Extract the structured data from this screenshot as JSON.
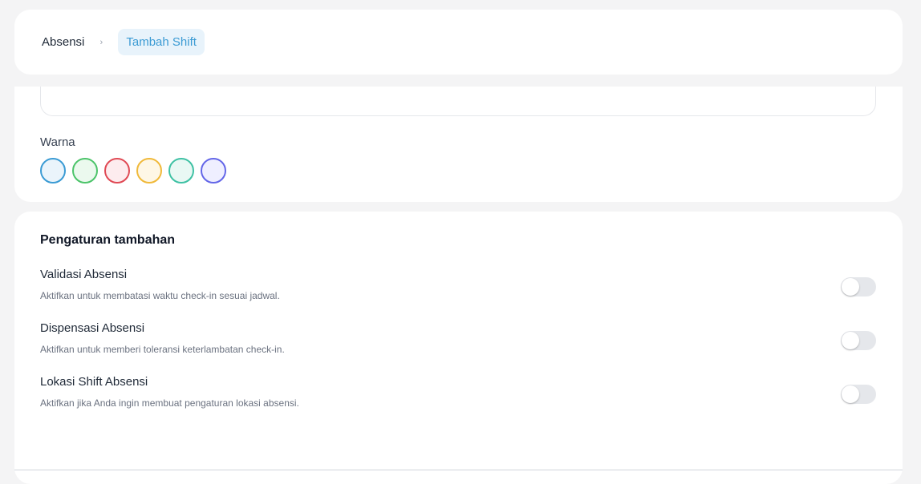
{
  "breadcrumb": {
    "root": "Absensi",
    "current": "Tambah Shift"
  },
  "form": {
    "color_label": "Warna",
    "colors": [
      {
        "name": "blue",
        "border": "#3b9bd4",
        "fill": "#eaf4fb"
      },
      {
        "name": "green",
        "border": "#4cc46a",
        "fill": "#ebf9ee"
      },
      {
        "name": "red",
        "border": "#e04a55",
        "fill": "#fdecee"
      },
      {
        "name": "yellow",
        "border": "#f0b93a",
        "fill": "#fef7e6"
      },
      {
        "name": "teal",
        "border": "#3fc1a4",
        "fill": "#e9f8f4"
      },
      {
        "name": "indigo",
        "border": "#6366e8",
        "fill": "#efefff"
      }
    ]
  },
  "settings": {
    "title": "Pengaturan tambahan",
    "items": [
      {
        "title": "Validasi Absensi",
        "description": "Aktifkan untuk membatasi waktu check-in sesuai jadwal.",
        "enabled": false
      },
      {
        "title": "Dispensasi Absensi",
        "description": "Aktifkan untuk memberi toleransi keterlambatan check-in.",
        "enabled": false
      },
      {
        "title": "Lokasi Shift Absensi",
        "description": "Aktifkan jika Anda ingin membuat pengaturan lokasi absensi.",
        "enabled": false
      }
    ]
  }
}
